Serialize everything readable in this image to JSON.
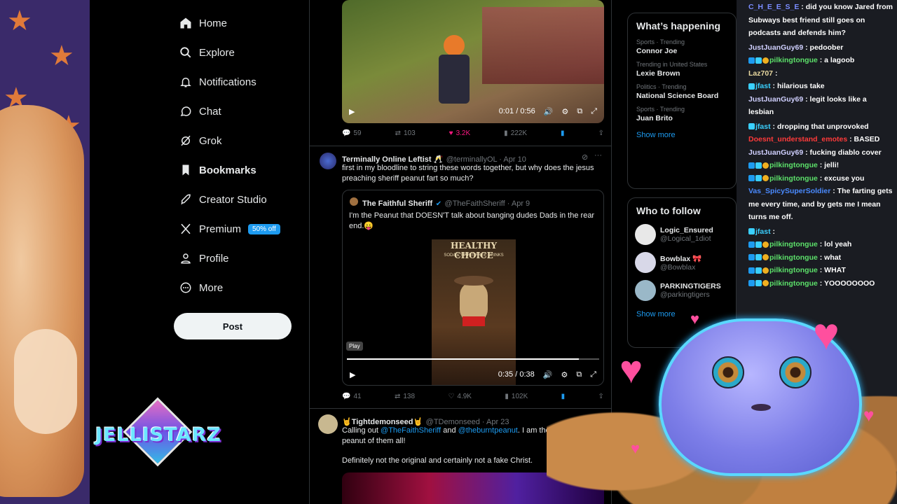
{
  "sidebar": {
    "items": [
      {
        "label": "Home",
        "icon": "home-icon"
      },
      {
        "label": "Explore",
        "icon": "search-icon"
      },
      {
        "label": "Notifications",
        "icon": "bell-icon"
      },
      {
        "label": "Chat",
        "icon": "chat-icon"
      },
      {
        "label": "Grok",
        "icon": "grok-icon"
      },
      {
        "label": "Bookmarks",
        "icon": "bookmark-icon"
      },
      {
        "label": "Creator Studio",
        "icon": "rocket-icon"
      },
      {
        "label": "Premium",
        "icon": "x-logo-icon",
        "badge": "50% off"
      },
      {
        "label": "Profile",
        "icon": "person-icon"
      },
      {
        "label": "More",
        "icon": "more-icon"
      }
    ],
    "post_label": "Post"
  },
  "overlay": {
    "logo_text": "JELLISTARZ"
  },
  "feed": {
    "video1": {
      "time": "0:01 / 0:56",
      "progress": 0.02
    },
    "tweet1_actions": {
      "replies": "59",
      "retweets": "103",
      "likes": "3.2K",
      "views": "222K"
    },
    "tweet2": {
      "name": "Terminally Online Leftist 🥂",
      "handle": "@terminallyOL · Apr 10",
      "text": "first in my bloodline to string these words together, but why does the jesus preaching sheriff peanut fart so much?",
      "quote": {
        "name": "The Faithful Sheriff",
        "handle": "@TheFaithSheriff · Apr 9",
        "text": "I'm the Peanut that DOESN'T talk about banging dudes Dads in the rear end.😛",
        "video_header": "HEALTHY CHOICE",
        "video_sub": "SODA & SPIRIT-FREE DRINKS",
        "tooltip": "Play",
        "time": "0:35 / 0:38",
        "progress": 0.92
      },
      "actions": {
        "replies": "41",
        "retweets": "138",
        "likes": "4.9K",
        "views": "102K"
      }
    },
    "tweet3": {
      "name": "🤘Tightdemonseed🤘",
      "handle": "@TDemonseed · Apr 23",
      "text_pre": "Calling out ",
      "mention1": "@TheFaithSheriff",
      "text_mid": " and ",
      "mention2": "@theburntpeanut",
      "text_post": ". I am the th",
      "text_line2": "peanut of them all!",
      "text_line3": "Definitely not the original and certainly not a fake Christ."
    }
  },
  "right": {
    "happening_title": "What’s happening",
    "trends": [
      {
        "category": "Sports · Trending",
        "name": "Connor Joe"
      },
      {
        "category": "Trending in United States",
        "name": "Lexie Brown"
      },
      {
        "category": "Politics · Trending",
        "name": "National Science Board"
      },
      {
        "category": "Sports · Trending",
        "name": "Juan Brito"
      }
    ],
    "show_more": "Show more",
    "follow_title": "Who to follow",
    "follow": [
      {
        "name": "Logic_Ensured",
        "handle": "@Logical_1diot",
        "color": "#e8e8e8"
      },
      {
        "name": "Bowblax 🎀",
        "handle": "@Bowblax",
        "color": "#d8d8e8"
      },
      {
        "name": "PARKINGTIGERS",
        "handle": "@parkingtigers",
        "color": "#9ab8c8"
      }
    ],
    "show_more2": "Show more"
  },
  "chat": {
    "messages": [
      {
        "user": "C_H_E_E_S_E",
        "text": "did you know Jared from",
        "color": "#7a8cff",
        "badges": []
      },
      {
        "user": "",
        "text": "Subways best friend still goes on",
        "color": "#ffffff",
        "badges": []
      },
      {
        "user": "",
        "text": "podcasts and defends him?",
        "color": "#ffffff",
        "badges": []
      },
      {
        "user": "JustJuanGuy69",
        "text": "pedoober",
        "color": "#d0d0ff",
        "badges": []
      },
      {
        "user": "pilkingtongue",
        "text": "a lagoob",
        "color": "#5ce06a",
        "badges": [
          "sub",
          "star",
          "gold"
        ]
      },
      {
        "user": "Laz707",
        "text": "",
        "color": "#e8d8a0",
        "badges": []
      },
      {
        "user": "jfast",
        "text": "hilarious take",
        "color": "#3ad0ff",
        "badges": [
          "star"
        ]
      },
      {
        "user": "JustJuanGuy69",
        "text": "legit looks like a",
        "color": "#d0d0ff",
        "badges": []
      },
      {
        "user": "",
        "text": "lesbian",
        "color": "#ffffff",
        "badges": []
      },
      {
        "user": "jfast",
        "text": "dropping that unprovoked",
        "color": "#3ad0ff",
        "badges": [
          "star"
        ]
      },
      {
        "user": "Doesnt_understand_emotes",
        "text": "BASED",
        "color": "#ff3a3a",
        "badges": []
      },
      {
        "user": "JustJuanGuy69",
        "text": "fucking diablo cover",
        "color": "#d0d0ff",
        "badges": []
      },
      {
        "user": "pilkingtongue",
        "text": "jelli!",
        "color": "#5ce06a",
        "badges": [
          "sub",
          "star",
          "gold"
        ]
      },
      {
        "user": "pilkingtongue",
        "text": "excuse you",
        "color": "#5ce06a",
        "badges": [
          "sub",
          "star",
          "gold"
        ]
      },
      {
        "user": "Vas_SpicySuperSoldier",
        "text": "The farting gets",
        "color": "#4a8aff",
        "badges": []
      },
      {
        "user": "",
        "text": "me every time, and by gets me I mean",
        "color": "#ffffff",
        "badges": []
      },
      {
        "user": "",
        "text": "turns me off.",
        "color": "#ffffff",
        "badges": []
      },
      {
        "user": "jfast",
        "text": "",
        "color": "#3ad0ff",
        "badges": [
          "star"
        ]
      },
      {
        "user": "pilkingtongue",
        "text": "lol yeah",
        "color": "#5ce06a",
        "badges": [
          "sub",
          "star",
          "gold"
        ]
      },
      {
        "user": "pilkingtongue",
        "text": "what",
        "color": "#5ce06a",
        "badges": [
          "sub",
          "star",
          "gold"
        ]
      },
      {
        "user": "pilkingtongue",
        "text": "WHAT",
        "color": "#5ce06a",
        "badges": [
          "sub",
          "star",
          "gold"
        ]
      },
      {
        "user": "pilkingtongue",
        "text": "YOOOOOOOO",
        "color": "#5ce06a",
        "badges": [
          "sub",
          "star",
          "gold"
        ]
      }
    ]
  }
}
